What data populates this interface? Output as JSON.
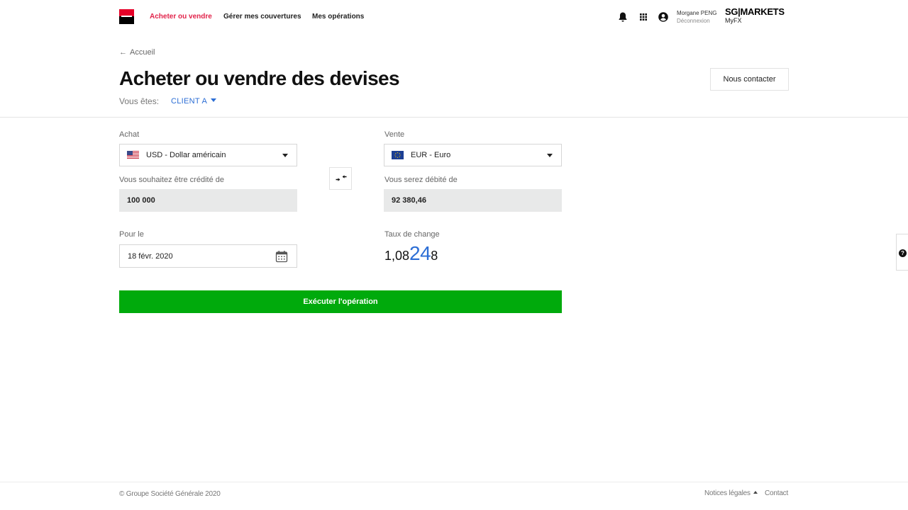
{
  "header": {
    "logo_icon": "societe-generale-logo",
    "nav": [
      {
        "label": "Acheter ou vendre",
        "active": true
      },
      {
        "label": "Gérer mes couvertures",
        "active": false
      },
      {
        "label": "Mes opérations",
        "active": false
      }
    ],
    "icons": [
      "bell-icon",
      "apps-grid-icon",
      "user-account-icon"
    ],
    "user_name": "Morgane PENG",
    "logout_label": "Déconnexion",
    "brand_main": "SG|MARKETS",
    "brand_sub": "MyFX"
  },
  "page": {
    "back_label": "Accueil",
    "title": "Acheter ou vendre des devises",
    "contact_button": "Nous contacter",
    "you_are_label": "Vous êtes:",
    "client": "CLIENT A"
  },
  "form": {
    "buy_label": "Achat",
    "buy_currency": "USD - Dollar américain",
    "sell_label": "Vente",
    "sell_currency": "EUR - Euro",
    "credit_label": "Vous souhaitez être crédité de",
    "credit_amount": "100 000",
    "debit_label": "Vous serez débité de",
    "debit_amount": "92 380,46",
    "date_label": "Pour le",
    "date_value": "18 févr. 2020",
    "rate_label": "Taux de change",
    "rate_prefix": "1,08",
    "rate_highlight": "24",
    "rate_suffix": "8",
    "execute_button": "Exécuter l'opération",
    "swap_icon": "swap-arrows-icon",
    "calendar_icon": "calendar-icon"
  },
  "colors": {
    "accent_red": "#e1234a",
    "link_blue": "#2c6ed5",
    "execute_green": "#00aa0c",
    "amount_bg": "#e8e9e9"
  },
  "footer": {
    "copyright": "© Groupe Société Générale 2020",
    "legal_label": "Notices légales",
    "contact_label": "Contact"
  },
  "help_tab": {
    "icon": "question-icon",
    "label": "?"
  }
}
